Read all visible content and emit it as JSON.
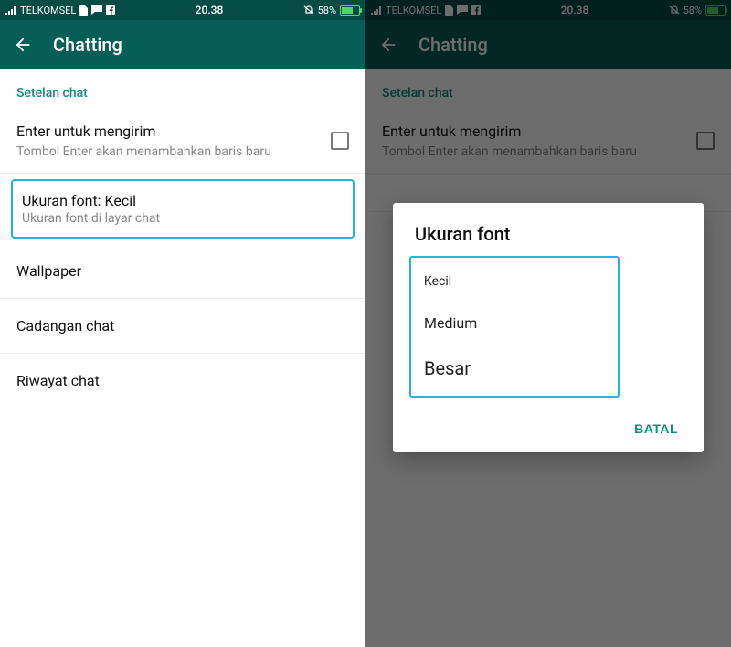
{
  "status": {
    "carrier": "TELKOMSEL",
    "time": "20.38",
    "battery_pct": "58%"
  },
  "appbar": {
    "title": "Chatting"
  },
  "settings": {
    "section_header": "Setelan chat",
    "enter_to_send": {
      "title": "Enter untuk mengirim",
      "subtitle": "Tombol Enter akan menambahkan baris baru"
    },
    "font_size": {
      "title": "Ukuran font: Kecil",
      "subtitle": "Ukuran font di layar chat"
    },
    "wallpaper": "Wallpaper",
    "backup": "Cadangan chat",
    "history": "Riwayat chat"
  },
  "dialog": {
    "title": "Ukuran font",
    "options": {
      "small": "Kecil",
      "medium": "Medium",
      "large": "Besar"
    },
    "cancel": "BATAL"
  }
}
